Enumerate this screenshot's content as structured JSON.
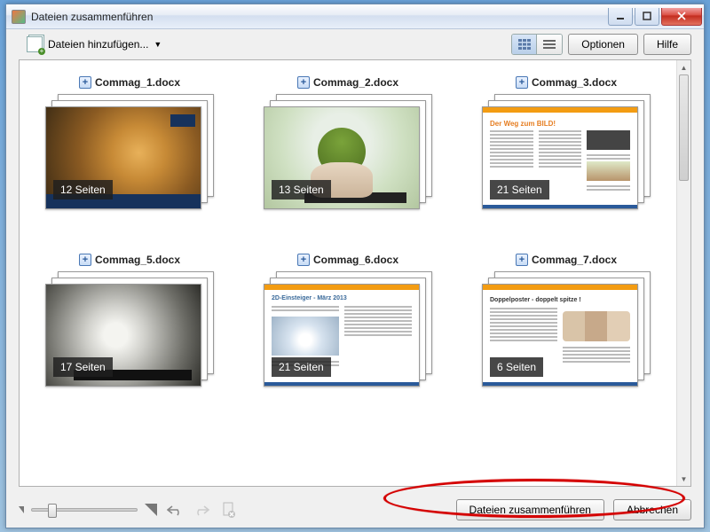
{
  "window": {
    "title": "Dateien zusammenführen"
  },
  "toolbar": {
    "add_files_label": "Dateien hinzufügen...",
    "options_label": "Optionen",
    "help_label": "Hilfe"
  },
  "files": [
    {
      "name": "Commag_1.docx",
      "pages_label": "12 Seiten",
      "thumb": "lion"
    },
    {
      "name": "Commag_2.docx",
      "pages_label": "13 Seiten",
      "thumb": "green"
    },
    {
      "name": "Commag_3.docx",
      "pages_label": "21 Seiten",
      "thumb": "doc3"
    },
    {
      "name": "Commag_5.docx",
      "pages_label": "17 Seiten",
      "thumb": "flower"
    },
    {
      "name": "Commag_6.docx",
      "pages_label": "21 Seiten",
      "thumb": "doc6"
    },
    {
      "name": "Commag_7.docx",
      "pages_label": "6 Seiten",
      "thumb": "doc7"
    }
  ],
  "doc3": {
    "headline": "Der Weg zum BILD!"
  },
  "doc6": {
    "headline": "2D-Einsteiger - März 2013"
  },
  "doc7": {
    "headline": "Doppelposter - doppelt spitze !"
  },
  "footer": {
    "combine_label": "Dateien zusammenführen",
    "cancel_label": "Abbrechen"
  }
}
